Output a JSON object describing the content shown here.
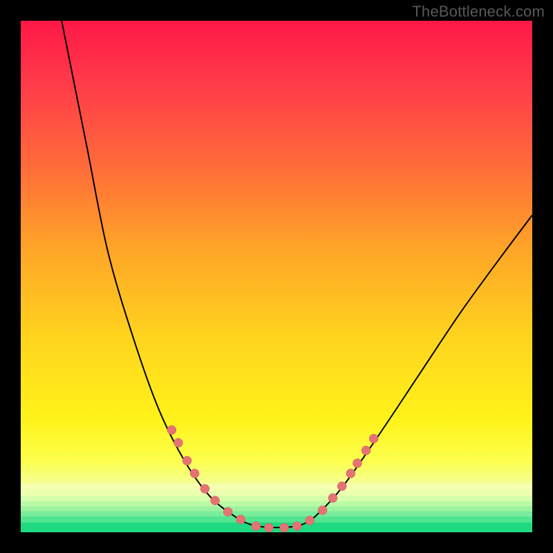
{
  "watermark": "TheBottleneck.com",
  "colors": {
    "page_bg": "#000000",
    "curve": "#000000",
    "marker_fill": "#e57373",
    "marker_stroke": "#c85a5a"
  },
  "gradient_stops": [
    {
      "offset": 0.0,
      "color": "#ff1846"
    },
    {
      "offset": 0.12,
      "color": "#ff3a4a"
    },
    {
      "offset": 0.28,
      "color": "#ff6a3a"
    },
    {
      "offset": 0.45,
      "color": "#ffa627"
    },
    {
      "offset": 0.62,
      "color": "#ffd41e"
    },
    {
      "offset": 0.78,
      "color": "#fff31a"
    },
    {
      "offset": 0.86,
      "color": "#fcff4d"
    },
    {
      "offset": 0.91,
      "color": "#f4ff9a"
    },
    {
      "offset": 0.94,
      "color": "#d8ffa5"
    },
    {
      "offset": 0.965,
      "color": "#9cf7a0"
    },
    {
      "offset": 0.985,
      "color": "#3fe68d"
    },
    {
      "offset": 1.0,
      "color": "#17d980"
    }
  ],
  "bottom_bands": [
    {
      "y": 0.905,
      "h": 0.012,
      "color": "#f6ffb0"
    },
    {
      "y": 0.917,
      "h": 0.012,
      "color": "#eaffb0"
    },
    {
      "y": 0.929,
      "h": 0.01,
      "color": "#d6ffac"
    },
    {
      "y": 0.939,
      "h": 0.01,
      "color": "#bcfaa5"
    },
    {
      "y": 0.949,
      "h": 0.01,
      "color": "#9df2a0"
    },
    {
      "y": 0.959,
      "h": 0.01,
      "color": "#7aec9a"
    },
    {
      "y": 0.969,
      "h": 0.012,
      "color": "#52e490"
    },
    {
      "y": 0.981,
      "h": 0.019,
      "color": "#1fda83"
    }
  ],
  "chart_data": {
    "type": "line",
    "title": "",
    "xlabel": "",
    "ylabel": "",
    "xlim": [
      0,
      100
    ],
    "ylim": [
      0,
      100
    ],
    "curve": [
      {
        "x": 8.0,
        "y": 100.0
      },
      {
        "x": 10.0,
        "y": 90.0
      },
      {
        "x": 13.0,
        "y": 75.0
      },
      {
        "x": 17.0,
        "y": 55.0
      },
      {
        "x": 22.0,
        "y": 38.0
      },
      {
        "x": 27.0,
        "y": 24.0
      },
      {
        "x": 32.0,
        "y": 14.0
      },
      {
        "x": 37.0,
        "y": 7.0
      },
      {
        "x": 42.0,
        "y": 3.0
      },
      {
        "x": 45.0,
        "y": 1.5
      },
      {
        "x": 48.0,
        "y": 1.0
      },
      {
        "x": 52.0,
        "y": 1.0
      },
      {
        "x": 55.0,
        "y": 1.5
      },
      {
        "x": 58.0,
        "y": 3.5
      },
      {
        "x": 63.0,
        "y": 9.0
      },
      {
        "x": 70.0,
        "y": 19.0
      },
      {
        "x": 78.0,
        "y": 31.0
      },
      {
        "x": 86.0,
        "y": 43.0
      },
      {
        "x": 94.0,
        "y": 54.0
      },
      {
        "x": 100.0,
        "y": 62.0
      }
    ],
    "markers": [
      {
        "x": 29.5,
        "y": 20.0
      },
      {
        "x": 30.8,
        "y": 17.5
      },
      {
        "x": 32.5,
        "y": 14.0
      },
      {
        "x": 34.0,
        "y": 11.5
      },
      {
        "x": 36.0,
        "y": 8.5
      },
      {
        "x": 38.0,
        "y": 6.2
      },
      {
        "x": 40.5,
        "y": 4.0
      },
      {
        "x": 43.0,
        "y": 2.5
      },
      {
        "x": 46.0,
        "y": 1.2
      },
      {
        "x": 48.5,
        "y": 0.9
      },
      {
        "x": 51.5,
        "y": 0.9
      },
      {
        "x": 54.0,
        "y": 1.2
      },
      {
        "x": 56.5,
        "y": 2.3
      },
      {
        "x": 59.0,
        "y": 4.3
      },
      {
        "x": 61.0,
        "y": 6.7
      },
      {
        "x": 62.8,
        "y": 9.0
      },
      {
        "x": 64.5,
        "y": 11.5
      },
      {
        "x": 65.8,
        "y": 13.5
      },
      {
        "x": 67.5,
        "y": 16.0
      },
      {
        "x": 69.0,
        "y": 18.3
      }
    ],
    "marker_radius": 6.5
  }
}
